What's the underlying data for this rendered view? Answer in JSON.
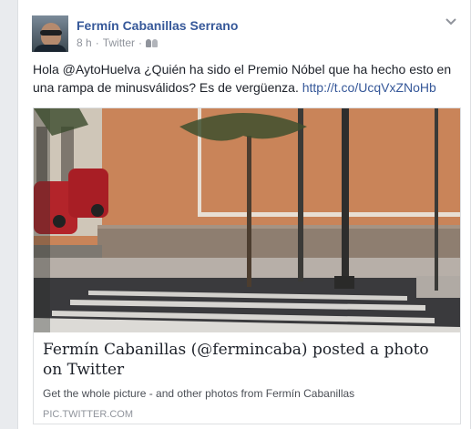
{
  "post": {
    "author": "Fermín Cabanillas Serrano",
    "time": "8 h",
    "separator": "·",
    "source": "Twitter",
    "separator2": "·",
    "text_before_link": "Hola @AytoHuelva ¿Quién ha sido el Premio Nóbel que ha hecho esto en una rampa de minusválidos? Es de vergüenza.",
    "link_text": "http://t.co/UcqVxZNoHb"
  },
  "icons": {
    "audience": "friends-icon",
    "menu": "chevron-down-icon"
  },
  "link_card": {
    "title": "Fermín Cabanillas (@fermincaba) posted a photo on Twitter",
    "description": "Get the whole picture - and other photos from Fermín Cabanillas",
    "domain": "PIC.TWITTER.COM"
  },
  "colors": {
    "link_blue": "#365899",
    "meta_gray": "#90949c",
    "wall_orange": "#c98459"
  }
}
